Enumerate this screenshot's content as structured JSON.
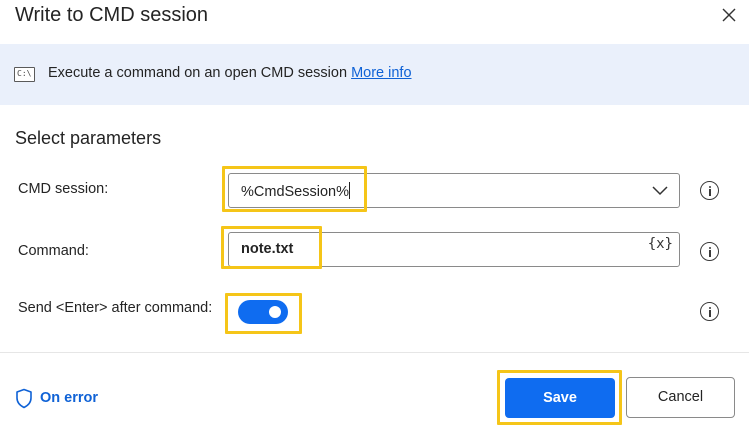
{
  "dialog": {
    "title": "Write to CMD session"
  },
  "banner": {
    "icon": "cmd-console-icon",
    "icon_text": "C:\\",
    "description": "Execute a command on an open CMD session",
    "link_label": "More info"
  },
  "section": {
    "title": "Select parameters"
  },
  "fields": {
    "cmd_session": {
      "label": "CMD session:",
      "value": "%CmdSession%"
    },
    "command": {
      "label": "Command:",
      "value": "note.txt",
      "variable_button": "{x}"
    },
    "send_enter": {
      "label": "Send <Enter> after command:",
      "enabled": true
    }
  },
  "footer": {
    "on_error_label": "On error",
    "save_label": "Save",
    "cancel_label": "Cancel"
  },
  "colors": {
    "accent": "#0f6cf0",
    "link": "#0f62d6",
    "banner_bg": "#eaf0fb",
    "highlight": "#f5c518"
  }
}
